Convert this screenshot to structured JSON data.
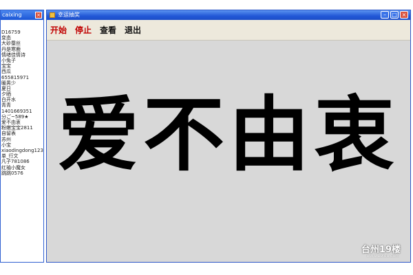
{
  "left_window": {
    "title": "caixing",
    "close_glyph": "×",
    "items": [
      "D16759",
      "变态",
      "大砂蚕丝",
      "丹是寒鹿",
      "情绪佳情诗",
      "小兔子",
      "宝宝",
      "西瓜",
      "655815971",
      "暖男少",
      "夏日",
      "夕晒",
      "白开水",
      "青青",
      "1401669351",
      "分ご~589★",
      "爱不由衷",
      "粉嫩宝宝2811",
      "自留表",
      "苏州",
      "小宝",
      "xiaodingdong123",
      "单_行文",
      "凡子781086",
      "红袖小魔女",
      "跳跳0576"
    ]
  },
  "main_window": {
    "title": "幸运抽奖",
    "minimize_glyph": "–",
    "maximize_glyph": "□",
    "close_glyph": "×",
    "menu": {
      "start": "开始",
      "stop": "停止",
      "view": "查看",
      "exit": "退出"
    },
    "current_name": "爱不由衷"
  },
  "watermark": {
    "text": "台州19楼",
    "sub": "www.19lou.com"
  },
  "colors": {
    "titlebar": "#2157d6",
    "menubar": "#ede9dc",
    "accent_red": "#c00000",
    "content_bg": "#d8d8d8"
  }
}
